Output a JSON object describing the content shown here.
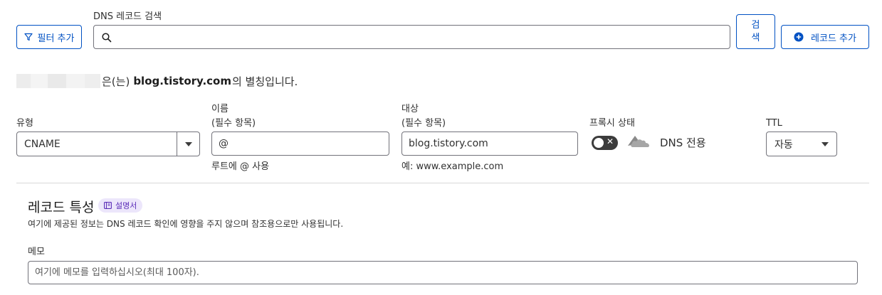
{
  "toolbar": {
    "filter_label": "필터 추가",
    "search_label": "DNS 레코드 검색",
    "search_value": "",
    "search_button": "검색",
    "add_record_label": "레코드 추가"
  },
  "alias_notice": {
    "prefix": "은(는)",
    "domain": "blog.tistory.com",
    "suffix": "의 별칭입니다."
  },
  "form": {
    "type": {
      "label": "유형",
      "value": "CNAME"
    },
    "name": {
      "label_line1": "이름",
      "label_line2": "(필수 항목)",
      "value": "@",
      "helper": "루트에 @ 사용"
    },
    "target": {
      "label_line1": "대상",
      "label_line2": "(필수 항목)",
      "value": "blog.tistory.com",
      "helper": "예: www.example.com"
    },
    "proxy": {
      "label": "프록시 상태",
      "status": "DNS 전용",
      "enabled": false
    },
    "ttl": {
      "label": "TTL",
      "value": "자동"
    }
  },
  "record_properties": {
    "title": "레코드 특성",
    "docs_badge": "설명서",
    "description": "여기에 제공된 정보는 DNS 레코드 확인에 영향을 주지 않으며 참조용으로만 사용됩니다.",
    "memo_label": "메모",
    "memo_placeholder": "여기에 메모를 입력하십시오(최대 100자)."
  },
  "colors": {
    "accent": "#0051c3",
    "border": "#72727a",
    "badge_bg": "#ece6fb",
    "badge_text": "#5b2db8"
  },
  "icons": [
    "filter-icon",
    "search-icon",
    "plus-circle-icon",
    "dropdown-arrow-icon",
    "cloud-icon",
    "book-icon"
  ]
}
